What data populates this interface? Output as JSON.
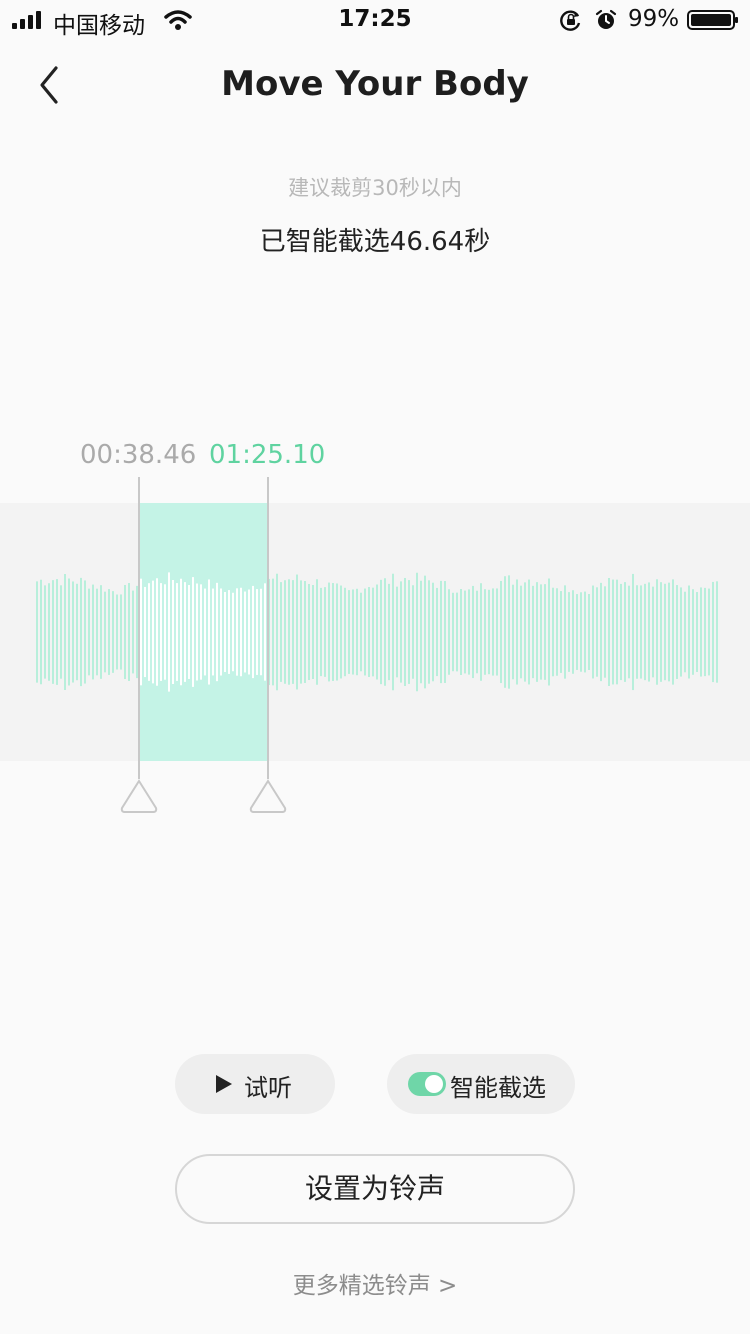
{
  "status_bar": {
    "carrier": "中国移动",
    "time": "17:25",
    "battery": "99%"
  },
  "nav": {
    "title": "Move Your Body"
  },
  "hint": "建议裁剪30秒以内",
  "selected_info": "已智能截选46.64秒",
  "trim": {
    "start": "00:38.46",
    "end": "01:25.10"
  },
  "controls": {
    "preview_label": "试听",
    "smart_label": "智能截选",
    "smart_enabled": true,
    "set_ringtone_label": "设置为铃声",
    "more_label": "更多精选铃声 >"
  },
  "colors": {
    "accent": "#5fd3a0",
    "selection": "#c4f3e6",
    "wave": "#b8efdb",
    "wave_selected": "#ffffff"
  },
  "icons": [
    "signal-icon",
    "wifi-icon",
    "rotation-lock-icon",
    "alarm-icon",
    "battery-icon",
    "back-icon",
    "play-icon",
    "toggle-switch"
  ]
}
